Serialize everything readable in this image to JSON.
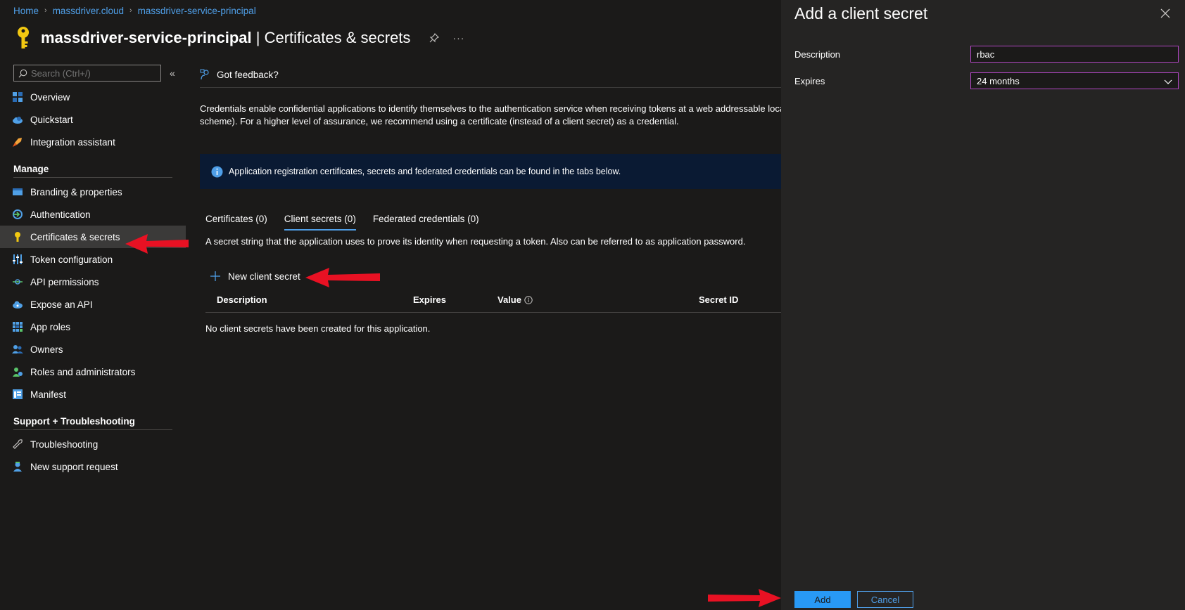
{
  "breadcrumb": [
    "Home",
    "massdriver.cloud",
    "massdriver-service-principal"
  ],
  "header": {
    "app_name": "massdriver-service-principal",
    "separator": "|",
    "page_name": "Certificates & secrets",
    "more": "···"
  },
  "sidebar": {
    "search_placeholder": "Search (Ctrl+/)",
    "collapse": "«",
    "top_items": [
      {
        "label": "Overview",
        "icon": "grid-icon"
      },
      {
        "label": "Quickstart",
        "icon": "cloud-icon"
      },
      {
        "label": "Integration assistant",
        "icon": "rocket-icon"
      }
    ],
    "manage_header": "Manage",
    "manage_items": [
      {
        "label": "Branding & properties",
        "icon": "branding-icon"
      },
      {
        "label": "Authentication",
        "icon": "auth-icon"
      },
      {
        "label": "Certificates & secrets",
        "icon": "key-icon",
        "active": true
      },
      {
        "label": "Token configuration",
        "icon": "sliders-icon"
      },
      {
        "label": "API permissions",
        "icon": "api-icon"
      },
      {
        "label": "Expose an API",
        "icon": "cloud-expose-icon"
      },
      {
        "label": "App roles",
        "icon": "grid-roles-icon"
      },
      {
        "label": "Owners",
        "icon": "owners-icon"
      },
      {
        "label": "Roles and administrators",
        "icon": "roles-icon"
      },
      {
        "label": "Manifest",
        "icon": "manifest-icon"
      }
    ],
    "support_header": "Support + Troubleshooting",
    "support_items": [
      {
        "label": "Troubleshooting",
        "icon": "wrench-icon"
      },
      {
        "label": "New support request",
        "icon": "support-icon"
      }
    ]
  },
  "main": {
    "feedback": "Got feedback?",
    "description_line1": "Credentials enable confidential applications to identify themselves to the authentication service when receiving tokens at a web addressable loca",
    "description_line2": "scheme). For a higher level of assurance, we recommend using a certificate (instead of a client secret) as a credential.",
    "info_banner": "Application registration certificates, secrets and federated credentials can be found in the tabs below.",
    "tabs": [
      {
        "label": "Certificates (0)"
      },
      {
        "label": "Client secrets (0)",
        "active": true
      },
      {
        "label": "Federated credentials (0)"
      }
    ],
    "tab_hint": "A secret string that the application uses to prove its identity when requesting a token. Also can be referred to as application password.",
    "new_secret": "New client secret",
    "table_headers": [
      "Description",
      "Expires",
      "Value",
      "Secret ID"
    ],
    "empty_text": "No client secrets have been created for this application."
  },
  "panel": {
    "title": "Add a client secret",
    "description_label": "Description",
    "description_value": "rbac",
    "expires_label": "Expires",
    "expires_value": "24 months",
    "add_label": "Add",
    "cancel_label": "Cancel"
  },
  "colors": {
    "accent": "#4f9fe8",
    "primary_button": "#2899f5",
    "focus_border": "#b146c2",
    "annotation_arrow": "#e81123"
  }
}
